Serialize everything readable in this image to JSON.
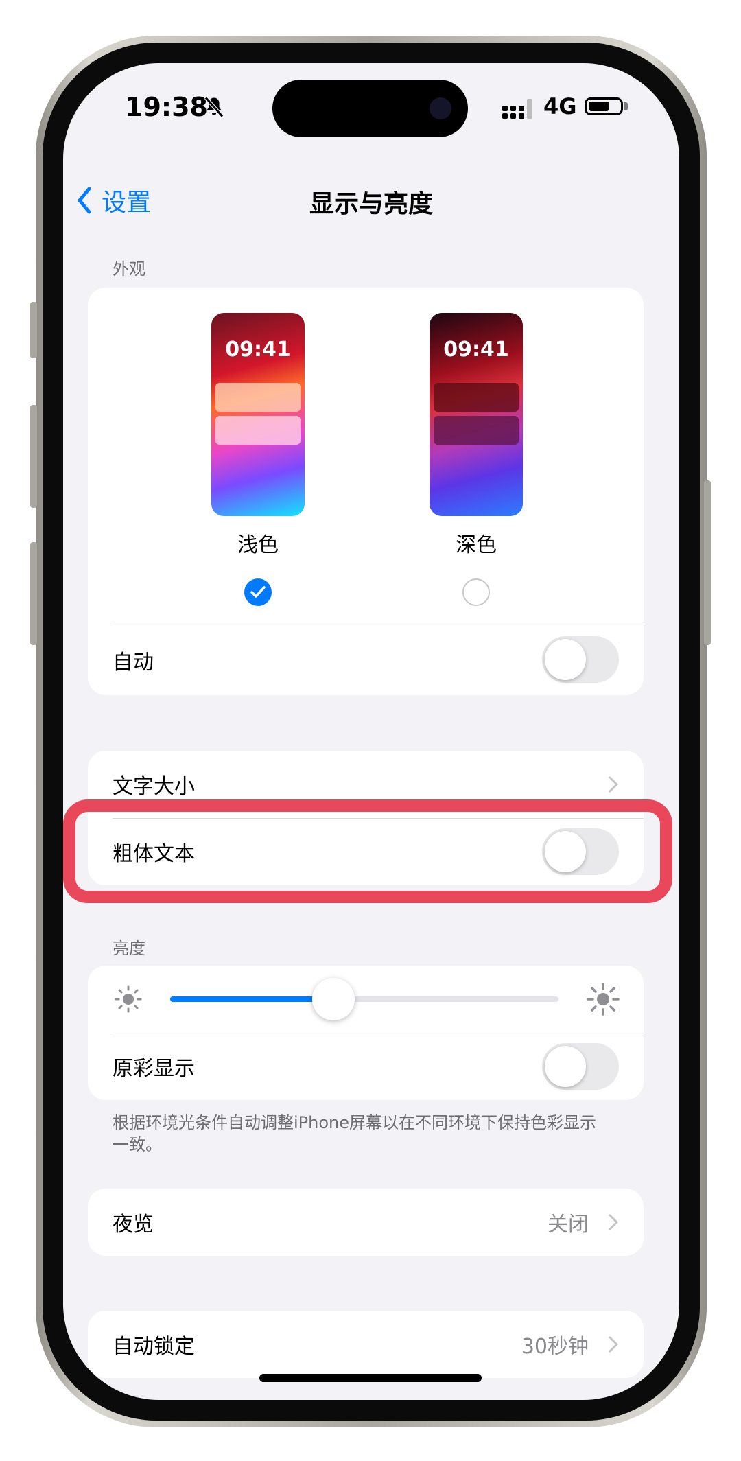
{
  "status_bar": {
    "time": "19:38",
    "network": "4G"
  },
  "nav": {
    "back_label": "设置",
    "title": "显示与亮度"
  },
  "appearance": {
    "section_label": "外观",
    "light": {
      "preview_time": "09:41",
      "label": "浅色",
      "selected": true
    },
    "dark": {
      "preview_time": "09:41",
      "label": "深色",
      "selected": false
    },
    "auto_label": "自动",
    "auto_on": false
  },
  "text": {
    "text_size_label": "文字大小",
    "bold_text_label": "粗体文本",
    "bold_on": false
  },
  "brightness": {
    "section_label": "亮度",
    "level": 0.42,
    "true_tone_label": "原彩显示",
    "true_tone_on": false,
    "note": "根据环境光条件自动调整iPhone屏幕以在不同环境下保持色彩显示一致。"
  },
  "night_shift": {
    "label": "夜览",
    "value": "关闭"
  },
  "auto_lock": {
    "label": "自动锁定",
    "value": "30秒钟"
  },
  "colors": {
    "accent": "#007aff",
    "highlight": "#e8485a",
    "background": "#f2f2f7"
  }
}
